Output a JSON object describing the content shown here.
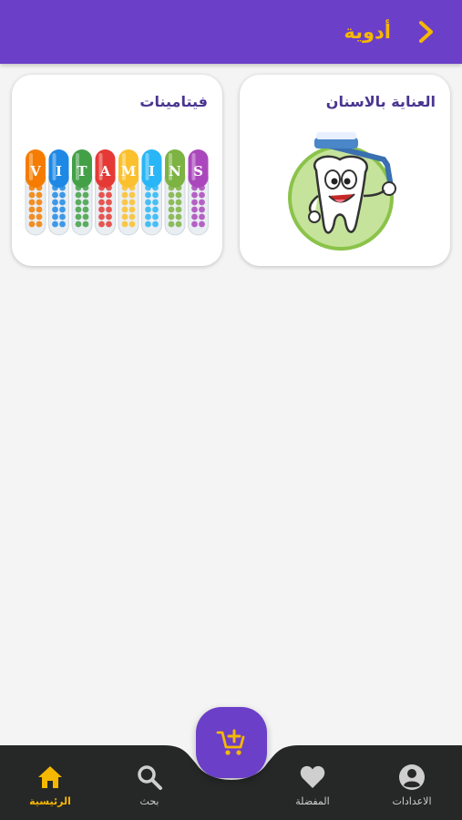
{
  "header": {
    "title": "أدوية",
    "back_icon": "chevron-right-icon",
    "background": "#6b3fc8",
    "accent": "#f5b800"
  },
  "categories": [
    {
      "label": "العناية بالاسنان",
      "image": "tooth-mascot"
    },
    {
      "label": "فيتامينات",
      "image": "vitamins-capsules"
    }
  ],
  "vitamins_letters": [
    "V",
    "I",
    "T",
    "A",
    "M",
    "I",
    "N",
    "S"
  ],
  "fab": {
    "icon": "add-to-cart-icon"
  },
  "nav": {
    "settings": "الاعدادات",
    "favorites": "المفضلة",
    "search": "بحث",
    "home": "الرئيسية",
    "active": "home"
  }
}
